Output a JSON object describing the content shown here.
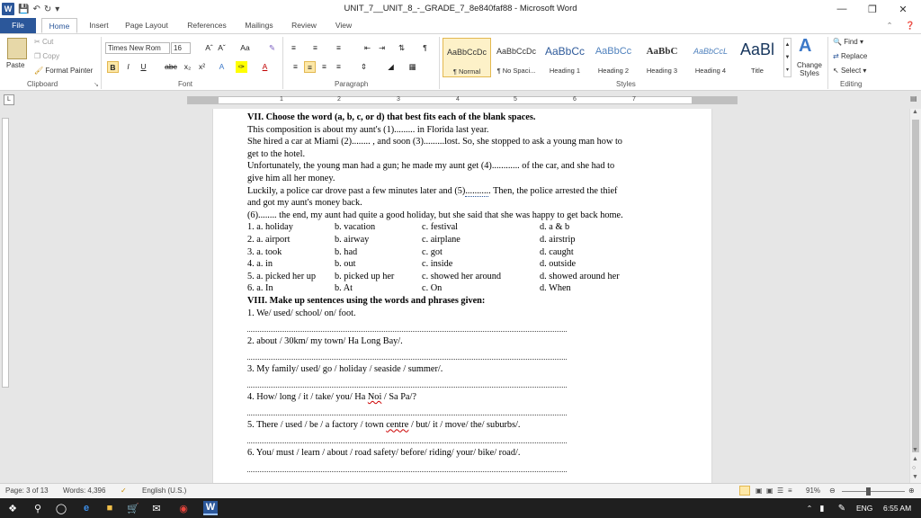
{
  "window": {
    "title": "UNIT_7__UNIT_8_-_GRADE_7_8e840faf88 - Microsoft Word"
  },
  "tabs": [
    "File",
    "Home",
    "Insert",
    "Page Layout",
    "References",
    "Mailings",
    "Review",
    "View"
  ],
  "ribbon": {
    "clipboard": {
      "paste": "Paste",
      "cut": "Cut",
      "copy": "Copy",
      "format_painter": "Format Painter",
      "label": "Clipboard"
    },
    "font": {
      "name": "Times New Rom",
      "size": "16",
      "label": "Font"
    },
    "paragraph": {
      "label": "Paragraph"
    },
    "styles": {
      "label": "Styles",
      "change_styles": "Change Styles",
      "items": [
        {
          "preview": "AaBbCcDc",
          "name": "¶ Normal"
        },
        {
          "preview": "AaBbCcDc",
          "name": "¶ No Spaci..."
        },
        {
          "preview": "AaBbCc",
          "name": "Heading 1"
        },
        {
          "preview": "AaBbCc",
          "name": "Heading 2"
        },
        {
          "preview": "AaBbC",
          "name": "Heading 3"
        },
        {
          "preview": "AaBbCcL",
          "name": "Heading 4"
        },
        {
          "preview": "AaBl",
          "name": "Title"
        }
      ]
    },
    "editing": {
      "find": "Find",
      "replace": "Replace",
      "select": "Select",
      "label": "Editing"
    }
  },
  "ruler": {
    "numbers": [
      "1",
      "2",
      "3",
      "4",
      "5",
      "6",
      "7"
    ]
  },
  "document": {
    "sec7_heading": "VII. Choose the word (a, b, c, or d) that best fits each of the blank spaces.",
    "p1": "This composition is about my aunt's (1)......... in Florida last year.",
    "p2a": "She hired a car at Miami (2)........ , and soon (3).........lost. So, she stopped to ask a young man how to",
    "p2b": "get to the hotel.",
    "p3a": "Unfortunately, the young man had a gun; he made my aunt get (4)............ of the car, and she had to",
    "p3b": "give him all her money.",
    "p4a": "Luckily, a police car drove past a few minutes later and (5)",
    "p4dots": "..........",
    "p4b": ". Then, the police arrested the thief",
    "p4c": "and got my aunt's money back.",
    "p5": "(6)........ the end, my aunt had quite a good holiday, but she said that she was happy to get back home.",
    "options": [
      [
        "1. a. holiday",
        "b. vacation",
        "c. festival",
        "d. a & b"
      ],
      [
        "2. a. airport",
        "b. airway",
        "c. airplane",
        "d. airstrip"
      ],
      [
        "3. a. took",
        "b. had",
        "c. got",
        "d. caught"
      ],
      [
        "4. a. in",
        "b. out",
        "c. inside",
        "d. outside"
      ],
      [
        "5. a. picked her up",
        "b. picked up her",
        "c. showed her around",
        "d. showed around her"
      ],
      [
        "6. a. In",
        "b. At",
        "c. On",
        "d. When"
      ]
    ],
    "sec8_heading": "VIII. Make up sentences using the words and phrases given:",
    "s1": "1. We/ used/ school/ on/ foot.",
    "s2": "2. about / 30km/ my town/ Ha Long Bay/.",
    "s3": "3. My family/ used/ go / holiday / seaside / summer/.",
    "s4a": "4. How/ long / it / take/ you/ Ha ",
    "s4b": "Noi",
    "s4c": " / Sa Pa/?",
    "s5a": "5. There / used / be / a factory / town ",
    "s5b": "centre",
    "s5c": " / but/ it / move/ the/ suburbs/.",
    "s6": "6. You/ must / learn / about / road safety/ before/ riding/ your/ bike/ road/."
  },
  "status": {
    "page": "Page: 3 of 13",
    "words": "Words: 4,396",
    "lang": "English (U.S.)",
    "zoom": "91%"
  },
  "taskbar": {
    "lang": "ENG",
    "time": "6:55 AM"
  },
  "colors": {
    "accent": "#2b579a",
    "taskbar": "#1f1f1f"
  }
}
